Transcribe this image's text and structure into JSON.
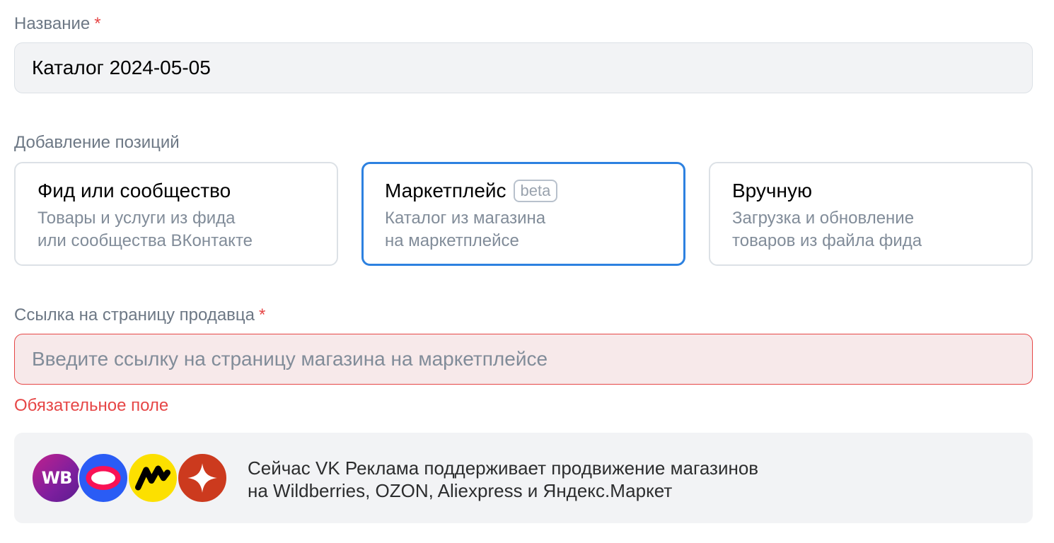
{
  "name_field": {
    "label": "Название",
    "required_mark": "*",
    "value": "Каталог 2024-05-05"
  },
  "positions": {
    "label": "Добавление позиций",
    "options": [
      {
        "title": "Фид или сообщество",
        "desc_line1": "Товары и услуги из фида",
        "desc_line2": "или сообщества ВКонтакте",
        "selected": false
      },
      {
        "title": "Маркетплейс",
        "badge": "beta",
        "desc_line1": "Каталог из магазина",
        "desc_line2": "на маркетплейсе",
        "selected": true
      },
      {
        "title": "Вручную",
        "desc_line1": "Загрузка и обновление",
        "desc_line2": "товаров из файла фида",
        "selected": false
      }
    ]
  },
  "seller_link": {
    "label": "Ссылка на страницу продавца",
    "required_mark": "*",
    "placeholder": "Введите ссылку на страницу магазина на маркетплейсе",
    "value": "",
    "error": "Обязательное поле"
  },
  "info": {
    "line1": "Сейчас VK Реклама поддерживает продвижение магазинов",
    "line2": "на Wildberries, OZON, Aliexpress и Яндекс.Маркет",
    "logos": [
      {
        "icon": "wildberries-logo-icon",
        "text": "WB"
      },
      {
        "icon": "ozon-logo-icon"
      },
      {
        "icon": "yandex-market-logo-icon"
      },
      {
        "icon": "aliexpress-logo-icon"
      }
    ]
  },
  "colors": {
    "accent": "#2d81e0",
    "error": "#e64646",
    "error_bg": "#f7e9ea",
    "muted_text": "#818c99",
    "field_bg": "#f2f3f5"
  }
}
